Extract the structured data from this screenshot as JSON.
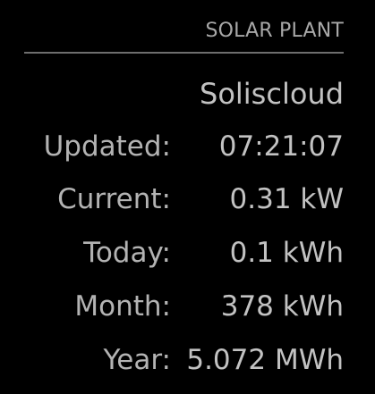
{
  "header": {
    "title": "SOLAR PLANT"
  },
  "module": {
    "name": "Soliscloud"
  },
  "rows": [
    {
      "label": "Updated:",
      "value": "07:21:07"
    },
    {
      "label": "Current:",
      "value": "0.31 kW"
    },
    {
      "label": "Today:",
      "value": "0.1 kWh"
    },
    {
      "label": "Month:",
      "value": "378 kWh"
    },
    {
      "label": "Year:",
      "value": "5.072 MWh"
    }
  ]
}
